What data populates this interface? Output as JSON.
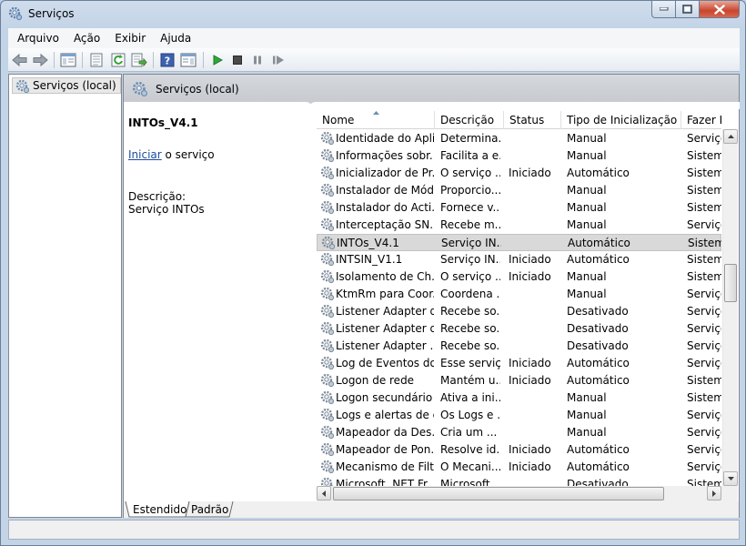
{
  "window": {
    "title": "Serviços"
  },
  "menu": [
    "Arquivo",
    "Ação",
    "Exibir",
    "Ajuda"
  ],
  "tree": {
    "root_label": "Serviços (local)"
  },
  "right_pane": {
    "header": "Serviços (local)",
    "selected_service": {
      "name": "INTOs_V4.1",
      "action_link": "Iniciar",
      "action_suffix": " o serviço",
      "description_label": "Descrição:",
      "description": "Serviço INTOs"
    }
  },
  "columns": [
    "Nome",
    "Descrição",
    "Status",
    "Tipo de Inicialização",
    "Fazer Lo"
  ],
  "rows": [
    {
      "name": "Identidade do Apli...",
      "desc": "Determina...",
      "status": "",
      "startup": "Manual",
      "logon": "Serviço"
    },
    {
      "name": "Informações sobr...",
      "desc": "Facilita a e...",
      "status": "",
      "startup": "Manual",
      "logon": "Sistema"
    },
    {
      "name": "Inicializador de Pr...",
      "desc": "O serviço ...",
      "status": "Iniciado",
      "startup": "Automático",
      "logon": "Sistema"
    },
    {
      "name": "Instalador de Mód...",
      "desc": "Proporcio...",
      "status": "",
      "startup": "Manual",
      "logon": "Sistema"
    },
    {
      "name": "Instalador do Acti...",
      "desc": "Fornece v...",
      "status": "",
      "startup": "Manual",
      "logon": "Sistema"
    },
    {
      "name": "Interceptação SN...",
      "desc": "Recebe m...",
      "status": "",
      "startup": "Manual",
      "logon": "Serviço"
    },
    {
      "name": "INTOs_V4.1",
      "desc": "Serviço IN...",
      "status": "",
      "startup": "Automático",
      "logon": "Sistema"
    },
    {
      "name": "INTSIN_V1.1",
      "desc": "Serviço IN...",
      "status": "Iniciado",
      "startup": "Automático",
      "logon": "Sistema"
    },
    {
      "name": "Isolamento de Ch...",
      "desc": "O serviço ...",
      "status": "Iniciado",
      "startup": "Manual",
      "logon": "Sistema"
    },
    {
      "name": "KtmRm para Coor...",
      "desc": "Coordena ...",
      "status": "",
      "startup": "Manual",
      "logon": "Serviço"
    },
    {
      "name": "Listener Adapter d...",
      "desc": "Recebe so...",
      "status": "",
      "startup": "Desativado",
      "logon": "Serviço"
    },
    {
      "name": "Listener Adapter d...",
      "desc": "Recebe so...",
      "status": "",
      "startup": "Desativado",
      "logon": "Serviço"
    },
    {
      "name": "Listener Adapter ...",
      "desc": "Recebe so...",
      "status": "",
      "startup": "Desativado",
      "logon": "Serviço"
    },
    {
      "name": "Log de Eventos do...",
      "desc": "Esse serviç...",
      "status": "Iniciado",
      "startup": "Automático",
      "logon": "Serviço"
    },
    {
      "name": "Logon de rede",
      "desc": "Mantém u...",
      "status": "Iniciado",
      "startup": "Automático",
      "logon": "Sistema"
    },
    {
      "name": "Logon secundário",
      "desc": "Ativa a ini...",
      "status": "",
      "startup": "Manual",
      "logon": "Sistema"
    },
    {
      "name": "Logs e alertas de d...",
      "desc": "Os Logs e ...",
      "status": "",
      "startup": "Manual",
      "logon": "Serviço"
    },
    {
      "name": "Mapeador da Des...",
      "desc": "Cria um ...",
      "status": "",
      "startup": "Manual",
      "logon": "Serviço"
    },
    {
      "name": "Mapeador de Pon...",
      "desc": "Resolve id...",
      "status": "Iniciado",
      "startup": "Automático",
      "logon": "Serviço"
    },
    {
      "name": "Mecanismo de Filt...",
      "desc": "O Mecani...",
      "status": "Iniciado",
      "startup": "Automático",
      "logon": "Serviço"
    },
    {
      "name": "Microsoft .NET Fr...",
      "desc": "Microsoft ...",
      "status": "",
      "startup": "Desativado",
      "logon": "Sistema"
    }
  ],
  "selected_row_index": 6,
  "tabs": [
    "Estendido",
    "Padrão"
  ],
  "colors": {
    "selection": "#d9d9d9",
    "link": "#1a4c9c",
    "close_button": "#c9452e"
  }
}
